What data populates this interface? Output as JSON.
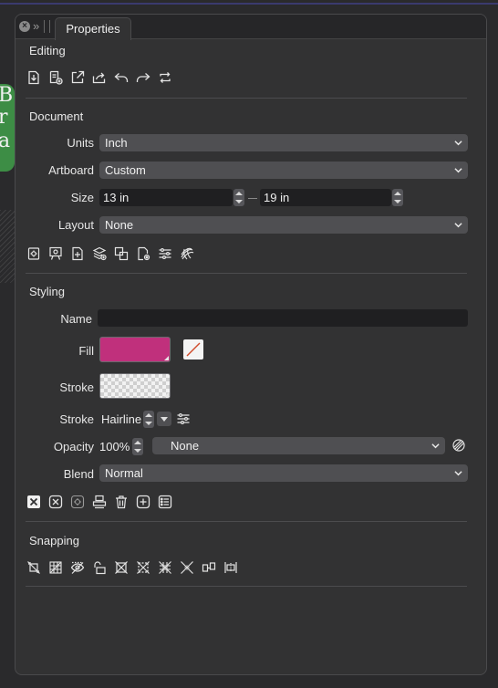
{
  "panel": {
    "tab_label": "Properties"
  },
  "editing": {
    "title": "Editing",
    "icons": [
      "import-icon",
      "new-from-clipboard-icon",
      "open-in-new-icon",
      "share-icon",
      "undo-icon",
      "redo-icon",
      "refresh-icon"
    ]
  },
  "document": {
    "title": "Document",
    "units": {
      "label": "Units",
      "value": "Inch"
    },
    "artboard": {
      "label": "Artboard",
      "value": "Custom"
    },
    "size": {
      "label": "Size",
      "width": "13 in",
      "height": "19 in"
    },
    "layout": {
      "label": "Layout",
      "value": "None"
    },
    "icons": [
      "document-setup-icon",
      "present-icon",
      "add-page-icon",
      "layers-add-icon",
      "duplicate-icon",
      "page-settings-icon",
      "adjust-sliders-icon",
      "grid-warp-icon"
    ]
  },
  "styling": {
    "title": "Styling",
    "name": {
      "label": "Name",
      "value": ""
    },
    "fill": {
      "label": "Fill",
      "color": "#c0307c"
    },
    "stroke_swatch": {
      "label": "Stroke"
    },
    "stroke_width": {
      "label": "Stroke",
      "value": "Hairline"
    },
    "opacity": {
      "label": "Opacity",
      "value": "100%",
      "mask": "None"
    },
    "blend": {
      "label": "Blend",
      "value": "Normal"
    },
    "icons": [
      "clear-style-icon",
      "remove-style-icon",
      "style-settings-icon",
      "stamp-icon",
      "trash-icon",
      "add-style-icon",
      "style-list-icon"
    ]
  },
  "snapping": {
    "title": "Snapping",
    "icons": [
      "snap-off-icon",
      "snap-grid-icon",
      "snap-visible-icon",
      "snap-lock-icon",
      "snap-box-icon",
      "snap-points-icon",
      "snap-grid-off-icon",
      "snap-cross-icon",
      "snap-align-left-icon",
      "snap-align-center-icon"
    ]
  },
  "colors": {
    "accent_fill": "#c0307c",
    "panel_bg": "#323233"
  }
}
